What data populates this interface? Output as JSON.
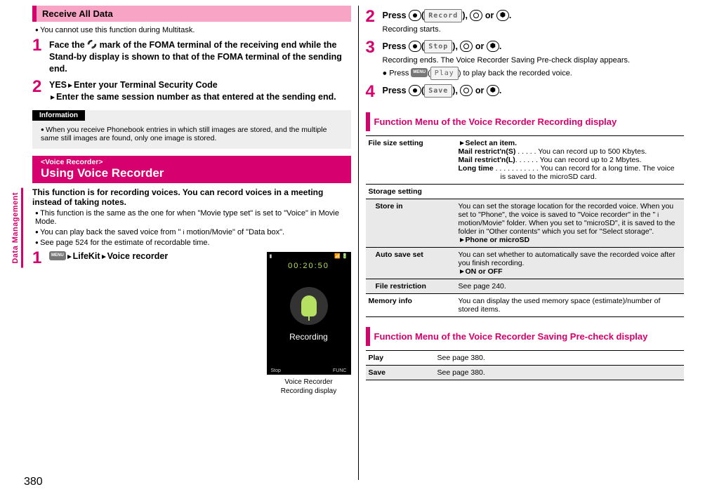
{
  "side_tab": "Data Management",
  "page_number": "380",
  "left": {
    "header1": "Receive All Data",
    "note1": "You cannot use this function during Multitask.",
    "step1": "Face the   mark of the FOMA terminal of the receiving end while the Stand-by display is shown to that of the FOMA terminal of the sending end.",
    "step2a": "YES",
    "step2b": "Enter your Terminal Security Code",
    "step2c": "Enter the same session number as that entered at the sending end.",
    "info_label": "Information",
    "info_text": "When you receive Phonebook entries in which still images are stored, and the multiple same still images are found, only one image is stored.",
    "sec2_tag": "<Voice Recorder>",
    "sec2_title": "Using Voice Recorder",
    "sec2_lead": "This function is for recording voices. You can record voices in a meeting instead of taking notes.",
    "sec2_b1": "This function is the same as the one for when \"Movie type set\" is set to \"Voice\" in Movie Mode.",
    "sec2_b2": "You can play back the saved voice from \"   motion/Movie\" of \"Data box\".",
    "sec2_b3": "See page 524 for the estimate of recordable time.",
    "sec2_step1_path": "LifeKit",
    "sec2_step1_end": "Voice recorder",
    "phone": {
      "time": "00:20:50",
      "label": "Recording",
      "sk_left": "Stop",
      "sk_right": "FUNC",
      "caption1": "Voice Recorder",
      "caption2": "Recording display"
    }
  },
  "right": {
    "step2_a": "Press ",
    "step2_body": "Recording starts.",
    "rec_label": "Record",
    "or": " or ",
    "period": ".",
    "step3_body1": "Recording ends. The Voice Recorder Saving Pre-check display appears.",
    "step3_body2_a": "Press ",
    "step3_body2_b": " to play back the recorded voice.",
    "stop_label": "Stop",
    "play_label": "Play",
    "save_label": "Save",
    "step4_a": "Press ",
    "fm1_title": "Function Menu of the Voice Recorder Recording display",
    "tbl1": {
      "r1k": "File size setting",
      "r1_sel": "Select an item.",
      "r1_l1": "Mail restrict'n(S)  . . . . . You can record up to 500 Kbytes.",
      "r1_l2": "Mail restrict'n(L) . . . . . . You can record up to 2 Mbytes.",
      "r1_l3": "Long time . . . . . . . . . . . You can record for a long time. The voice is saved to the microSD card.",
      "r2_head": "Storage setting",
      "r2a_k": "Store in",
      "r2a_v": "You can set the storage location for the recorded voice. When you set to \"Phone\", the voice is saved to \"Voice recorder\" in the \"   motion/Movie\" folder. When you set to \"microSD\", it is saved to the folder in \"Other contents\" which you set for \"Select storage\".",
      "r2a_opt": "Phone or microSD",
      "r2b_k": "Auto save set",
      "r2b_v": "You can set whether to automatically save the recorded voice after you finish recording.",
      "r2b_opt": "ON or OFF",
      "r2c_k": "File restriction",
      "r2c_v": "See page 240.",
      "r3k": "Memory info",
      "r3v": "You can display the used memory space (estimate)/number of stored items."
    },
    "fm2_title": "Function Menu of the Voice Recorder Saving Pre-check display",
    "tbl2": {
      "r1k": "Play",
      "r1v": "See page 380.",
      "r2k": "Save",
      "r2v": "See page 380."
    }
  }
}
